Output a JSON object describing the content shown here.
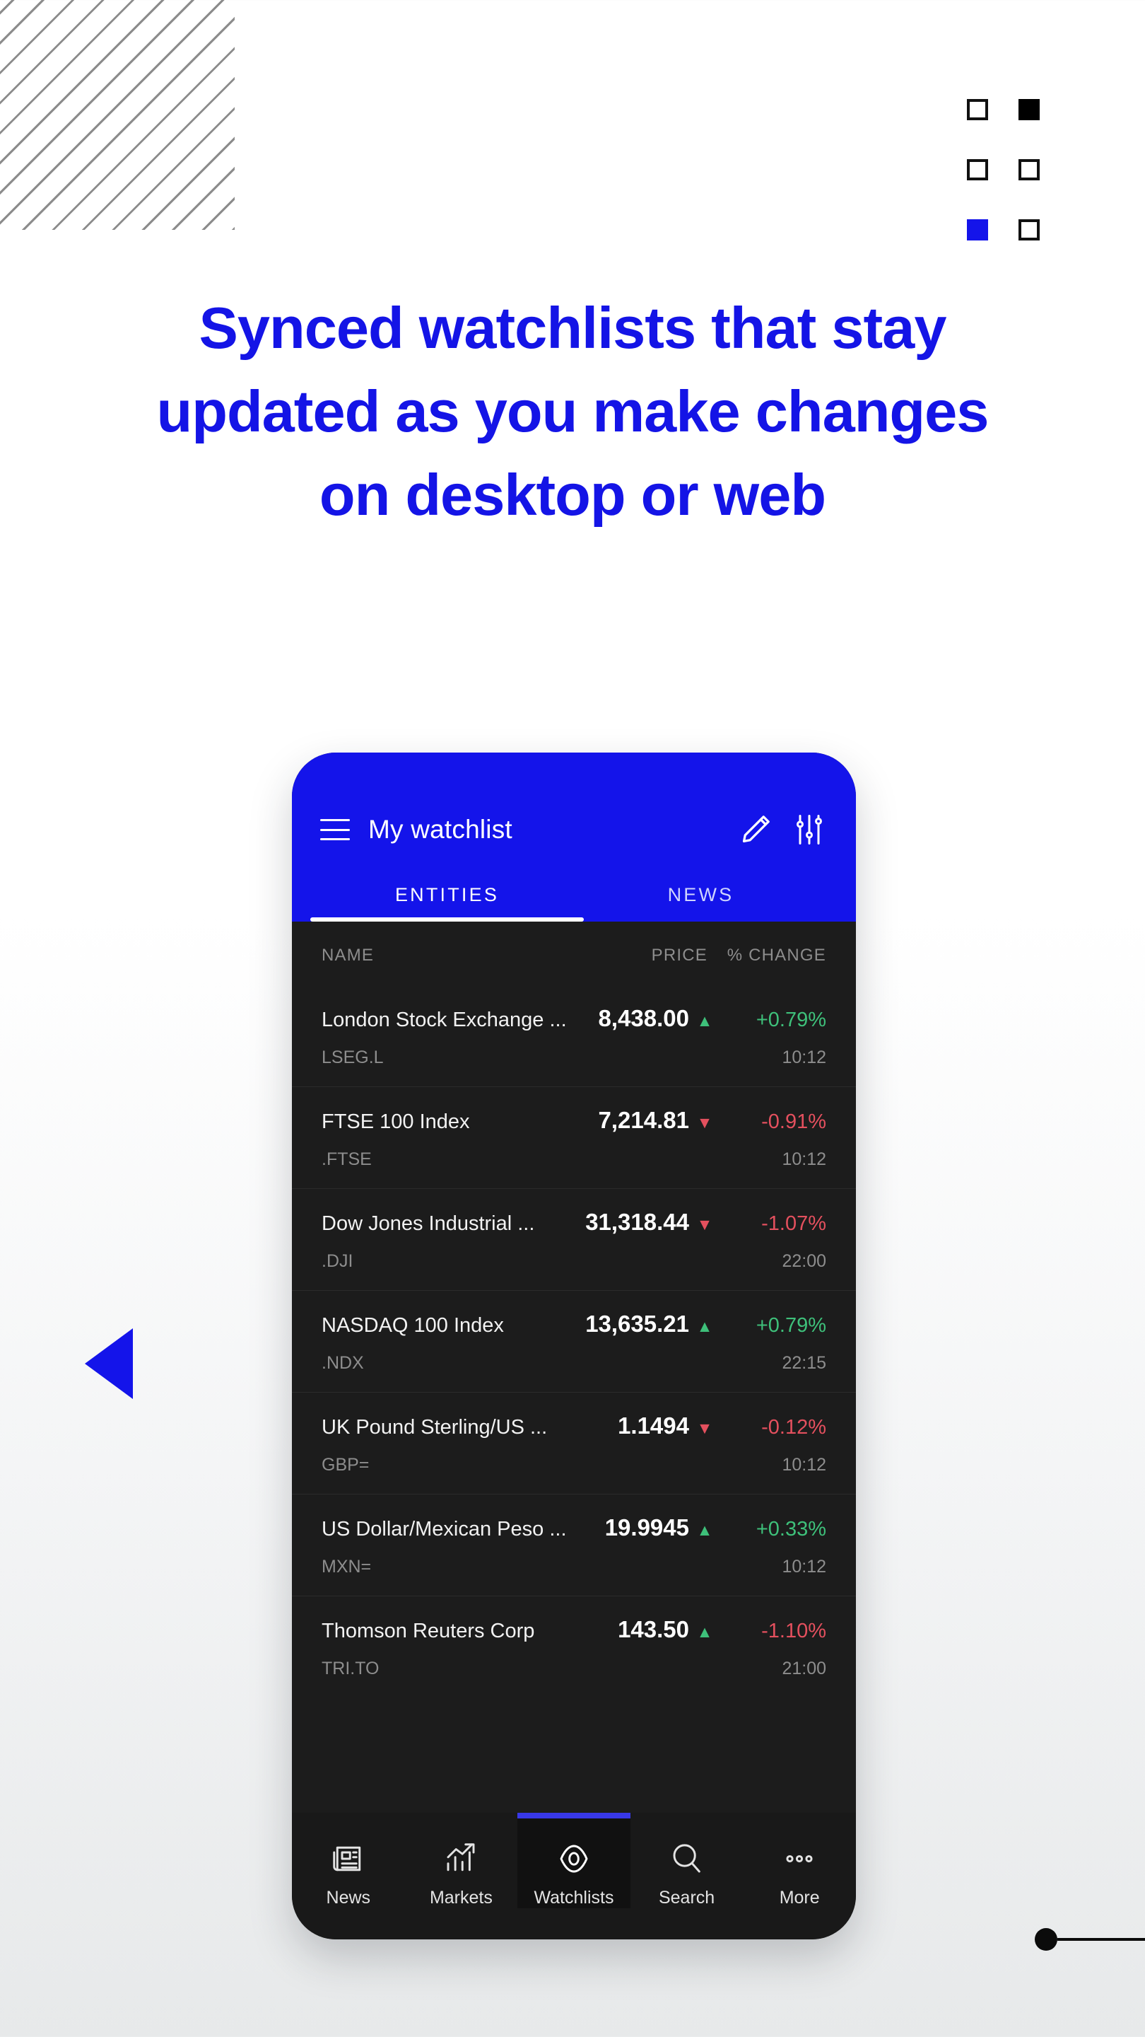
{
  "decor": {
    "hatch_name": "diagonal-stripes-pattern",
    "prev_arrow_name": "previous-slide-arrow",
    "accent_blue": "#1414EA",
    "squares": [
      {
        "style": "outline"
      },
      {
        "style": "black"
      },
      {
        "style": "outline"
      },
      {
        "style": "outline"
      },
      {
        "style": "blue"
      },
      {
        "style": "outline"
      }
    ]
  },
  "headline": {
    "text": "Synced watchlists that stay updated as you make changes on desktop or web",
    "color": "#1414E6"
  },
  "phone": {
    "header": {
      "menu_icon": "hamburger-menu-icon",
      "title": "My watchlist",
      "edit_icon": "pencil-edit-icon",
      "filter_icon": "sliders-filter-icon"
    },
    "tabs": [
      {
        "label": "ENTITIES",
        "active": true
      },
      {
        "label": "NEWS",
        "active": false
      }
    ],
    "table": {
      "columns": [
        "NAME",
        "PRICE",
        "% CHANGE"
      ],
      "rows": [
        {
          "name": "London Stock Exchange ...",
          "price": "8,438.00",
          "direction": "up",
          "arrow": "▲",
          "change": "+0.79%",
          "change_sign": "pos",
          "symbol": "LSEG.L",
          "time": "10:12"
        },
        {
          "name": "FTSE 100 Index",
          "price": "7,214.81",
          "direction": "down",
          "arrow": "▼",
          "change": "-0.91%",
          "change_sign": "neg",
          "symbol": ".FTSE",
          "time": "10:12"
        },
        {
          "name": "Dow Jones Industrial ...",
          "price": "31,318.44",
          "direction": "down",
          "arrow": "▼",
          "change": "-1.07%",
          "change_sign": "neg",
          "symbol": ".DJI",
          "time": "22:00"
        },
        {
          "name": "NASDAQ 100 Index",
          "price": "13,635.21",
          "direction": "up",
          "arrow": "▲",
          "change": "+0.79%",
          "change_sign": "pos",
          "symbol": ".NDX",
          "time": "22:15"
        },
        {
          "name": "UK Pound Sterling/US ...",
          "price": "1.1494",
          "direction": "down",
          "arrow": "▼",
          "change": "-0.12%",
          "change_sign": "neg",
          "symbol": "GBP=",
          "time": "10:12"
        },
        {
          "name": "US Dollar/Mexican Peso ...",
          "price": "19.9945",
          "direction": "up",
          "arrow": "▲",
          "change": "+0.33%",
          "change_sign": "pos",
          "symbol": "MXN=",
          "time": "10:12"
        },
        {
          "name": "Thomson Reuters Corp",
          "price": "143.50",
          "direction": "up",
          "arrow": "▲",
          "change": "-1.10%",
          "change_sign": "neg",
          "symbol": "TRI.TO",
          "time": "21:00"
        }
      ]
    },
    "bottom_nav": [
      {
        "label": "News",
        "icon": "newspaper-icon",
        "active": false
      },
      {
        "label": "Markets",
        "icon": "bar-chart-icon",
        "active": false
      },
      {
        "label": "Watchlists",
        "icon": "eye-icon",
        "active": true
      },
      {
        "label": "Search",
        "icon": "search-icon",
        "active": false
      },
      {
        "label": "More",
        "icon": "more-dots-icon",
        "active": false
      }
    ]
  }
}
